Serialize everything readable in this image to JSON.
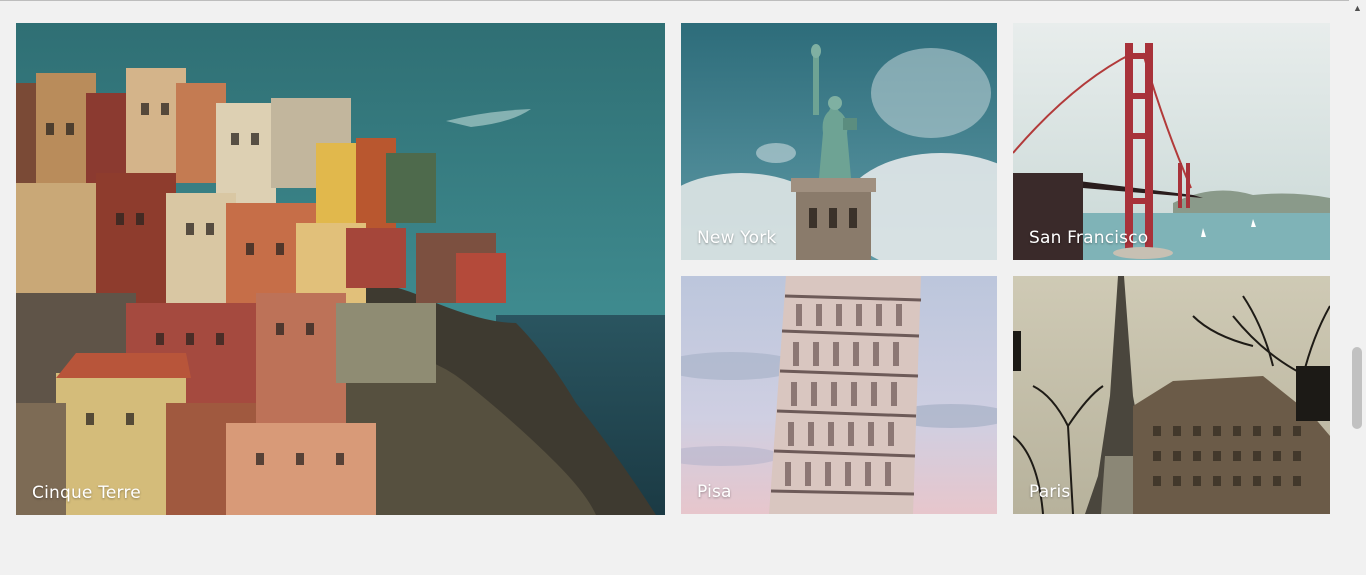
{
  "gallery": {
    "tiles": [
      {
        "caption": "Cinque Terre"
      },
      {
        "caption": "New York"
      },
      {
        "caption": "San Francisco"
      },
      {
        "caption": "Pisa"
      },
      {
        "caption": "Paris"
      }
    ]
  },
  "scrollbar": {
    "up_arrow": "▲",
    "thumb_position_fraction": 0.72
  }
}
